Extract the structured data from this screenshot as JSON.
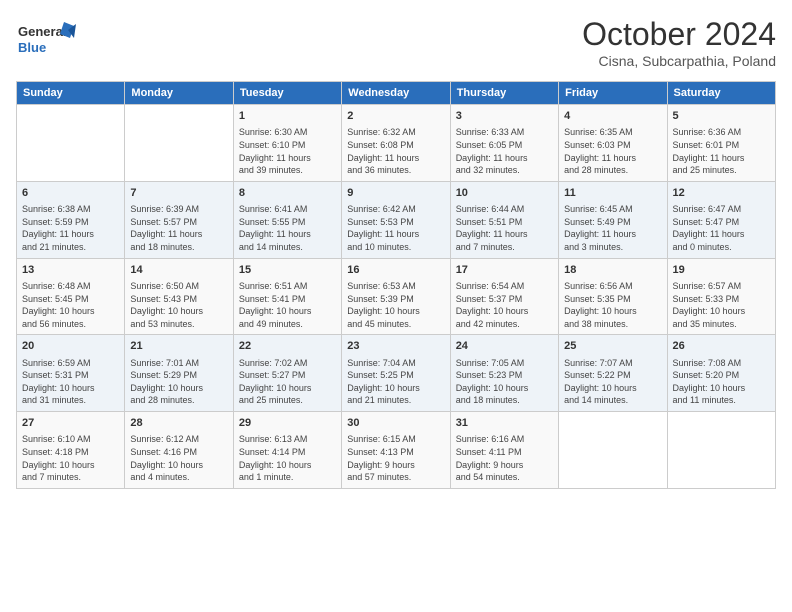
{
  "header": {
    "logo_line1": "General",
    "logo_line2": "Blue",
    "month": "October 2024",
    "location": "Cisna, Subcarpathia, Poland"
  },
  "weekdays": [
    "Sunday",
    "Monday",
    "Tuesday",
    "Wednesday",
    "Thursday",
    "Friday",
    "Saturday"
  ],
  "rows": [
    [
      {
        "day": "",
        "text": ""
      },
      {
        "day": "",
        "text": ""
      },
      {
        "day": "1",
        "text": "Sunrise: 6:30 AM\nSunset: 6:10 PM\nDaylight: 11 hours\nand 39 minutes."
      },
      {
        "day": "2",
        "text": "Sunrise: 6:32 AM\nSunset: 6:08 PM\nDaylight: 11 hours\nand 36 minutes."
      },
      {
        "day": "3",
        "text": "Sunrise: 6:33 AM\nSunset: 6:05 PM\nDaylight: 11 hours\nand 32 minutes."
      },
      {
        "day": "4",
        "text": "Sunrise: 6:35 AM\nSunset: 6:03 PM\nDaylight: 11 hours\nand 28 minutes."
      },
      {
        "day": "5",
        "text": "Sunrise: 6:36 AM\nSunset: 6:01 PM\nDaylight: 11 hours\nand 25 minutes."
      }
    ],
    [
      {
        "day": "6",
        "text": "Sunrise: 6:38 AM\nSunset: 5:59 PM\nDaylight: 11 hours\nand 21 minutes."
      },
      {
        "day": "7",
        "text": "Sunrise: 6:39 AM\nSunset: 5:57 PM\nDaylight: 11 hours\nand 18 minutes."
      },
      {
        "day": "8",
        "text": "Sunrise: 6:41 AM\nSunset: 5:55 PM\nDaylight: 11 hours\nand 14 minutes."
      },
      {
        "day": "9",
        "text": "Sunrise: 6:42 AM\nSunset: 5:53 PM\nDaylight: 11 hours\nand 10 minutes."
      },
      {
        "day": "10",
        "text": "Sunrise: 6:44 AM\nSunset: 5:51 PM\nDaylight: 11 hours\nand 7 minutes."
      },
      {
        "day": "11",
        "text": "Sunrise: 6:45 AM\nSunset: 5:49 PM\nDaylight: 11 hours\nand 3 minutes."
      },
      {
        "day": "12",
        "text": "Sunrise: 6:47 AM\nSunset: 5:47 PM\nDaylight: 11 hours\nand 0 minutes."
      }
    ],
    [
      {
        "day": "13",
        "text": "Sunrise: 6:48 AM\nSunset: 5:45 PM\nDaylight: 10 hours\nand 56 minutes."
      },
      {
        "day": "14",
        "text": "Sunrise: 6:50 AM\nSunset: 5:43 PM\nDaylight: 10 hours\nand 53 minutes."
      },
      {
        "day": "15",
        "text": "Sunrise: 6:51 AM\nSunset: 5:41 PM\nDaylight: 10 hours\nand 49 minutes."
      },
      {
        "day": "16",
        "text": "Sunrise: 6:53 AM\nSunset: 5:39 PM\nDaylight: 10 hours\nand 45 minutes."
      },
      {
        "day": "17",
        "text": "Sunrise: 6:54 AM\nSunset: 5:37 PM\nDaylight: 10 hours\nand 42 minutes."
      },
      {
        "day": "18",
        "text": "Sunrise: 6:56 AM\nSunset: 5:35 PM\nDaylight: 10 hours\nand 38 minutes."
      },
      {
        "day": "19",
        "text": "Sunrise: 6:57 AM\nSunset: 5:33 PM\nDaylight: 10 hours\nand 35 minutes."
      }
    ],
    [
      {
        "day": "20",
        "text": "Sunrise: 6:59 AM\nSunset: 5:31 PM\nDaylight: 10 hours\nand 31 minutes."
      },
      {
        "day": "21",
        "text": "Sunrise: 7:01 AM\nSunset: 5:29 PM\nDaylight: 10 hours\nand 28 minutes."
      },
      {
        "day": "22",
        "text": "Sunrise: 7:02 AM\nSunset: 5:27 PM\nDaylight: 10 hours\nand 25 minutes."
      },
      {
        "day": "23",
        "text": "Sunrise: 7:04 AM\nSunset: 5:25 PM\nDaylight: 10 hours\nand 21 minutes."
      },
      {
        "day": "24",
        "text": "Sunrise: 7:05 AM\nSunset: 5:23 PM\nDaylight: 10 hours\nand 18 minutes."
      },
      {
        "day": "25",
        "text": "Sunrise: 7:07 AM\nSunset: 5:22 PM\nDaylight: 10 hours\nand 14 minutes."
      },
      {
        "day": "26",
        "text": "Sunrise: 7:08 AM\nSunset: 5:20 PM\nDaylight: 10 hours\nand 11 minutes."
      }
    ],
    [
      {
        "day": "27",
        "text": "Sunrise: 6:10 AM\nSunset: 4:18 PM\nDaylight: 10 hours\nand 7 minutes."
      },
      {
        "day": "28",
        "text": "Sunrise: 6:12 AM\nSunset: 4:16 PM\nDaylight: 10 hours\nand 4 minutes."
      },
      {
        "day": "29",
        "text": "Sunrise: 6:13 AM\nSunset: 4:14 PM\nDaylight: 10 hours\nand 1 minute."
      },
      {
        "day": "30",
        "text": "Sunrise: 6:15 AM\nSunset: 4:13 PM\nDaylight: 9 hours\nand 57 minutes."
      },
      {
        "day": "31",
        "text": "Sunrise: 6:16 AM\nSunset: 4:11 PM\nDaylight: 9 hours\nand 54 minutes."
      },
      {
        "day": "",
        "text": ""
      },
      {
        "day": "",
        "text": ""
      }
    ]
  ]
}
